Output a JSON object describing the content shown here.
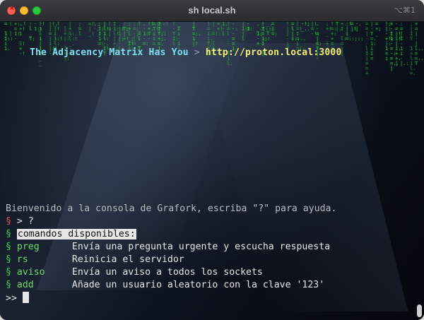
{
  "window": {
    "title": "sh local.sh",
    "shortcut": "⌥⌘1"
  },
  "banner": {
    "part1": "The Adjacency Matrix Has You",
    "separator": " > ",
    "url": "http://proton.local:3000"
  },
  "console": {
    "welcome": "Bienvenido a la consola de Grafork, escriba \"?\" para ayuda.",
    "prompt_marker": "§",
    "input_echo": "> ?",
    "commands_header": "comandos disponibles:",
    "commands": [
      {
        "name": "preg",
        "description": "Envía una pregunta urgente y escucha respuesta"
      },
      {
        "name": "rs",
        "description": "Reinicia el servidor"
      },
      {
        "name": "aviso",
        "description": "Envía un aviso a todos los sockets"
      },
      {
        "name": "add",
        "description": "Añade un usuario aleatorio con la clave '123'"
      }
    ],
    "active_prompt": ">>"
  },
  "colors": {
    "matrix_green": "#37d64a",
    "banner_cyan": "#7fe0f2",
    "banner_yellow": "#f5f07a",
    "marker_red": "#e2574c",
    "marker_green": "#3bd54f"
  }
}
